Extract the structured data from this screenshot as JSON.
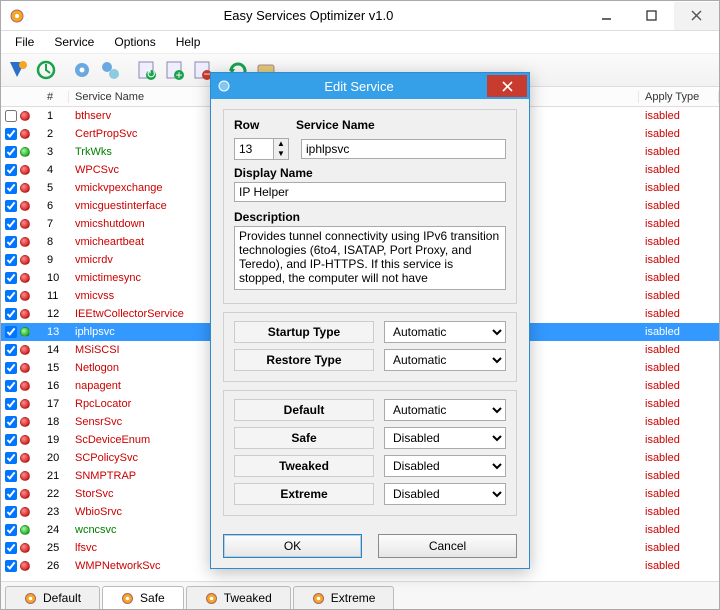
{
  "window": {
    "title": "Easy Services Optimizer v1.0",
    "menu": [
      "File",
      "Service",
      "Options",
      "Help"
    ]
  },
  "columns": {
    "num": "#",
    "name": "Service Name",
    "apply": "Apply Type"
  },
  "apply_label": "isabled",
  "rows": [
    {
      "n": "1",
      "name": "bthserv",
      "color": "red",
      "checked": false,
      "dot": "red"
    },
    {
      "n": "2",
      "name": "CertPropSvc",
      "color": "red",
      "checked": true,
      "dot": "red"
    },
    {
      "n": "3",
      "name": "TrkWks",
      "color": "green",
      "checked": true,
      "dot": "green"
    },
    {
      "n": "4",
      "name": "WPCSvc",
      "color": "red",
      "checked": true,
      "dot": "red"
    },
    {
      "n": "5",
      "name": "vmickvpexchange",
      "color": "red",
      "checked": true,
      "dot": "red"
    },
    {
      "n": "6",
      "name": "vmicguestinterface",
      "color": "red",
      "checked": true,
      "dot": "red"
    },
    {
      "n": "7",
      "name": "vmicshutdown",
      "color": "red",
      "checked": true,
      "dot": "red"
    },
    {
      "n": "8",
      "name": "vmicheartbeat",
      "color": "red",
      "checked": true,
      "dot": "red"
    },
    {
      "n": "9",
      "name": "vmicrdv",
      "color": "red",
      "checked": true,
      "dot": "red"
    },
    {
      "n": "10",
      "name": "vmictimesync",
      "color": "red",
      "checked": true,
      "dot": "red"
    },
    {
      "n": "11",
      "name": "vmicvss",
      "color": "red",
      "checked": true,
      "dot": "red"
    },
    {
      "n": "12",
      "name": "IEEtwCollectorService",
      "color": "red",
      "checked": true,
      "dot": "red"
    },
    {
      "n": "13",
      "name": "iphlpsvc",
      "color": "sel",
      "checked": true,
      "dot": "green",
      "selected": true
    },
    {
      "n": "14",
      "name": "MSiSCSI",
      "color": "red",
      "checked": true,
      "dot": "red"
    },
    {
      "n": "15",
      "name": "Netlogon",
      "color": "red",
      "checked": true,
      "dot": "red"
    },
    {
      "n": "16",
      "name": "napagent",
      "color": "red",
      "checked": true,
      "dot": "red"
    },
    {
      "n": "17",
      "name": "RpcLocator",
      "color": "red",
      "checked": true,
      "dot": "red"
    },
    {
      "n": "18",
      "name": "SensrSvc",
      "color": "red",
      "checked": true,
      "dot": "red"
    },
    {
      "n": "19",
      "name": "ScDeviceEnum",
      "color": "red",
      "checked": true,
      "dot": "red"
    },
    {
      "n": "20",
      "name": "SCPolicySvc",
      "color": "red",
      "checked": true,
      "dot": "red"
    },
    {
      "n": "21",
      "name": "SNMPTRAP",
      "color": "red",
      "checked": true,
      "dot": "red"
    },
    {
      "n": "22",
      "name": "StorSvc",
      "color": "red",
      "checked": true,
      "dot": "red"
    },
    {
      "n": "23",
      "name": "WbioSrvc",
      "color": "red",
      "checked": true,
      "dot": "red"
    },
    {
      "n": "24",
      "name": "wcncsvc",
      "color": "green",
      "checked": true,
      "dot": "green"
    },
    {
      "n": "25",
      "name": "lfsvc",
      "color": "red",
      "checked": true,
      "dot": "red"
    },
    {
      "n": "26",
      "name": "WMPNetworkSvc",
      "color": "red",
      "checked": true,
      "dot": "red"
    }
  ],
  "tabs": [
    "Default",
    "Safe",
    "Tweaked",
    "Extreme"
  ],
  "active_tab": 1,
  "dialog": {
    "title": "Edit Service",
    "row_label": "Row",
    "row_value": "13",
    "svcname_label": "Service Name",
    "svcname_value": "iphlpsvc",
    "dispname_label": "Display Name",
    "dispname_value": "IP Helper",
    "desc_label": "Description",
    "desc_value": "Provides tunnel connectivity using IPv6 transition technologies (6to4, ISATAP, Port Proxy, and Teredo), and IP-HTTPS. If this service is stopped, the computer will not have",
    "startup_label": "Startup Type",
    "restore_label": "Restore Type",
    "default_label": "Default",
    "safe_label": "Safe",
    "tweaked_label": "Tweaked",
    "extreme_label": "Extreme",
    "startup_value": "Automatic",
    "restore_value": "Automatic",
    "default_value": "Automatic",
    "safe_value": "Disabled",
    "tweaked_value": "Disabled",
    "extreme_value": "Disabled",
    "ok": "OK",
    "cancel": "Cancel"
  }
}
